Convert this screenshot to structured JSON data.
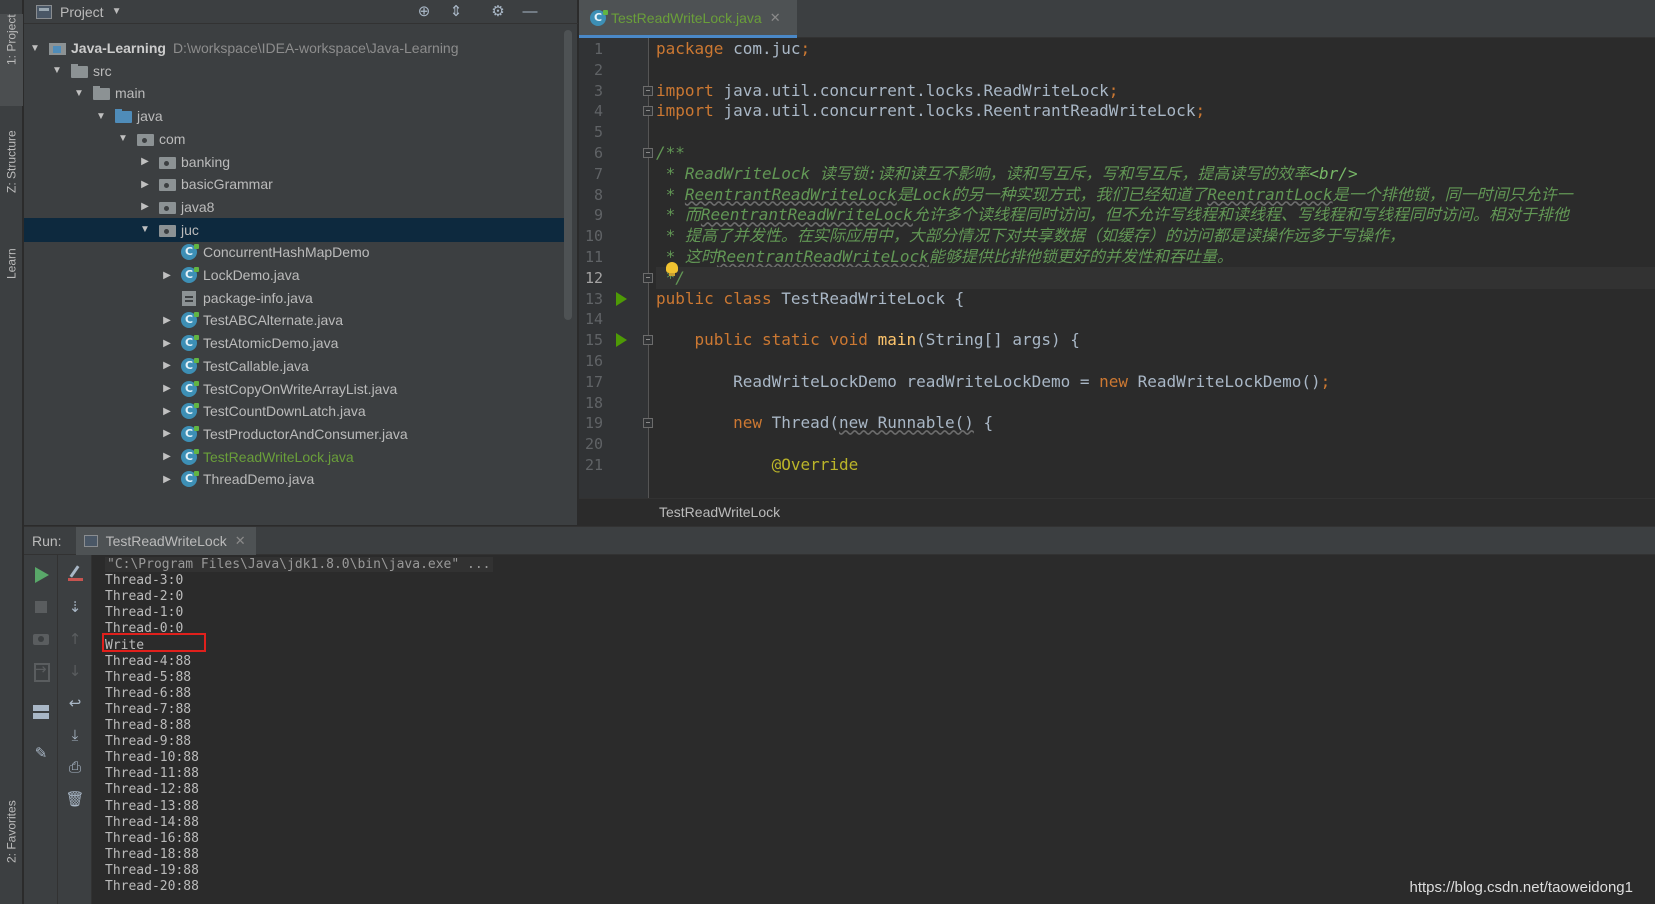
{
  "left_strip": {
    "project_tab": "1: Project",
    "structure_tab": "Z: Structure",
    "learn_tab": "Learn",
    "favorites_tab": "2: Favorites"
  },
  "project_panel": {
    "title": "Project",
    "tree": [
      {
        "label": "Java-Learning",
        "path": "D:\\workspace\\IDEA-workspace\\Java-Learning",
        "depth": 0,
        "expand": "open",
        "icon": "module-folder-icon"
      },
      {
        "label": "src",
        "depth": 1,
        "expand": "open",
        "icon": "folder-icon"
      },
      {
        "label": "main",
        "depth": 2,
        "expand": "open",
        "icon": "folder-icon"
      },
      {
        "label": "java",
        "depth": 3,
        "expand": "open",
        "icon": "source-folder-icon"
      },
      {
        "label": "com",
        "depth": 4,
        "expand": "open",
        "icon": "package-icon"
      },
      {
        "label": "banking",
        "depth": 5,
        "expand": "closed",
        "icon": "package-icon"
      },
      {
        "label": "basicGrammar",
        "depth": 5,
        "expand": "closed",
        "icon": "package-icon"
      },
      {
        "label": "java8",
        "depth": 5,
        "expand": "closed",
        "icon": "package-icon"
      },
      {
        "label": "juc",
        "depth": 5,
        "expand": "open",
        "icon": "package-icon",
        "selected": true
      },
      {
        "label": "ConcurrentHashMapDemo",
        "depth": 6,
        "expand": "none",
        "icon": "class-icon"
      },
      {
        "label": "LockDemo.java",
        "depth": 6,
        "expand": "closed",
        "icon": "class-icon"
      },
      {
        "label": "package-info.java",
        "depth": 6,
        "expand": "none",
        "icon": "package-info-icon"
      },
      {
        "label": "TestABCAlternate.java",
        "depth": 6,
        "expand": "closed",
        "icon": "class-icon"
      },
      {
        "label": "TestAtomicDemo.java",
        "depth": 6,
        "expand": "closed",
        "icon": "class-icon"
      },
      {
        "label": "TestCallable.java",
        "depth": 6,
        "expand": "closed",
        "icon": "class-icon"
      },
      {
        "label": "TestCopyOnWriteArrayList.java",
        "depth": 6,
        "expand": "closed",
        "icon": "class-icon"
      },
      {
        "label": "TestCountDownLatch.java",
        "depth": 6,
        "expand": "closed",
        "icon": "class-icon"
      },
      {
        "label": "TestProductorAndConsumer.java",
        "depth": 6,
        "expand": "closed",
        "icon": "class-icon"
      },
      {
        "label": "TestReadWriteLock.java",
        "depth": 6,
        "expand": "closed",
        "icon": "class-icon",
        "active": true
      },
      {
        "label": "ThreadDemo.java",
        "depth": 6,
        "expand": "closed",
        "icon": "class-icon"
      }
    ]
  },
  "editor": {
    "tab_label": "TestReadWriteLock.java",
    "breadcrumb": "TestReadWriteLock",
    "current_line": 12,
    "lines": [
      {
        "n": "1",
        "segs": [
          {
            "t": "package ",
            "c": "kw"
          },
          {
            "t": "com.juc",
            "c": ""
          },
          {
            "t": ";",
            "c": "kw"
          }
        ]
      },
      {
        "n": "2",
        "segs": []
      },
      {
        "n": "3",
        "segs": [
          {
            "t": "import ",
            "c": "kw"
          },
          {
            "t": "java.util.concurrent.locks.ReadWriteLock",
            "c": ""
          },
          {
            "t": ";",
            "c": "kw"
          }
        ]
      },
      {
        "n": "4",
        "segs": [
          {
            "t": "import ",
            "c": "kw"
          },
          {
            "t": "java.util.concurrent.locks.ReentrantReadWriteLock",
            "c": ""
          },
          {
            "t": ";",
            "c": "kw"
          }
        ]
      },
      {
        "n": "5",
        "segs": []
      },
      {
        "n": "6",
        "segs": [
          {
            "t": "/**",
            "c": "doc"
          }
        ]
      },
      {
        "n": "7",
        "segs": [
          {
            "t": " * ReadWriteLock 读写锁:读和读互不影响，读和写互斥，写和写互斥，提高读写的效率",
            "c": "doc"
          },
          {
            "t": "<br/>",
            "c": "doctag"
          }
        ]
      },
      {
        "n": "8",
        "segs": [
          {
            "t": " * ",
            "c": "doc"
          },
          {
            "t": "ReentrantReadWriteLock",
            "c": "doc uline"
          },
          {
            "t": "是Lock的另一种实现方式，我们已经知道了",
            "c": "doc"
          },
          {
            "t": "ReentrantLock",
            "c": "doc uline"
          },
          {
            "t": "是一个排他锁，同一时间只允许一",
            "c": "doc"
          }
        ]
      },
      {
        "n": "9",
        "segs": [
          {
            "t": " * 而",
            "c": "doc"
          },
          {
            "t": "ReentrantReadWriteLock",
            "c": "doc uline"
          },
          {
            "t": "允许多个读线程同时访问，但不允许写线程和读线程、写线程和写线程同时访问。相对于排他",
            "c": "doc"
          }
        ]
      },
      {
        "n": "10",
        "segs": [
          {
            "t": " * 提高了并发性。在实际应用中，大部分情况下对共享数据（如缓存）的访问都是读操作远多于写操作，",
            "c": "doc"
          }
        ]
      },
      {
        "n": "11",
        "segs": [
          {
            "t": " * 这时",
            "c": "doc"
          },
          {
            "t": "ReentrantReadWriteLock",
            "c": "doc uline"
          },
          {
            "t": "能够提供比排他锁更好的并发性和吞吐量。",
            "c": "doc"
          }
        ]
      },
      {
        "n": "12",
        "segs": [
          {
            "t": " */",
            "c": "doc"
          }
        ]
      },
      {
        "n": "13",
        "segs": [
          {
            "t": "public class ",
            "c": "kw"
          },
          {
            "t": "TestReadWriteLock {",
            "c": ""
          }
        ]
      },
      {
        "n": "14",
        "segs": []
      },
      {
        "n": "15",
        "segs": [
          {
            "t": "    public static void ",
            "c": "kw"
          },
          {
            "t": "main",
            "c": "fn"
          },
          {
            "t": "(String[] args) {",
            "c": ""
          }
        ]
      },
      {
        "n": "16",
        "segs": []
      },
      {
        "n": "17",
        "segs": [
          {
            "t": "        ReadWriteLockDemo readWriteLockDemo = ",
            "c": ""
          },
          {
            "t": "new ",
            "c": "kw"
          },
          {
            "t": "ReadWriteLockDemo()",
            "c": ""
          },
          {
            "t": ";",
            "c": "kw"
          }
        ]
      },
      {
        "n": "18",
        "segs": []
      },
      {
        "n": "19",
        "segs": [
          {
            "t": "        ",
            "c": ""
          },
          {
            "t": "new ",
            "c": "kw"
          },
          {
            "t": "Thread(",
            "c": ""
          },
          {
            "t": "new Runnable()",
            "c": "uline"
          },
          {
            "t": " {",
            "c": ""
          }
        ]
      },
      {
        "n": "20",
        "segs": []
      },
      {
        "n": "21",
        "segs": [
          {
            "t": "            ",
            "c": ""
          },
          {
            "t": "@Override",
            "c": "anno"
          }
        ]
      }
    ]
  },
  "run_panel": {
    "label": "Run:",
    "tab_label": "TestReadWriteLock",
    "console": [
      "\"C:\\Program Files\\Java\\jdk1.8.0\\bin\\java.exe\" ...",
      "Thread-3:0",
      "Thread-2:0",
      "Thread-1:0",
      "Thread-0:0",
      "Write",
      "Thread-4:88",
      "Thread-5:88",
      "Thread-6:88",
      "Thread-7:88",
      "Thread-8:88",
      "Thread-9:88",
      "Thread-10:88",
      "Thread-11:88",
      "Thread-12:88",
      "Thread-13:88",
      "Thread-14:88",
      "Thread-16:88",
      "Thread-18:88",
      "Thread-19:88",
      "Thread-20:88"
    ],
    "highlighted_line": 5
  },
  "watermark": "https://blog.csdn.net/taoweidong1"
}
